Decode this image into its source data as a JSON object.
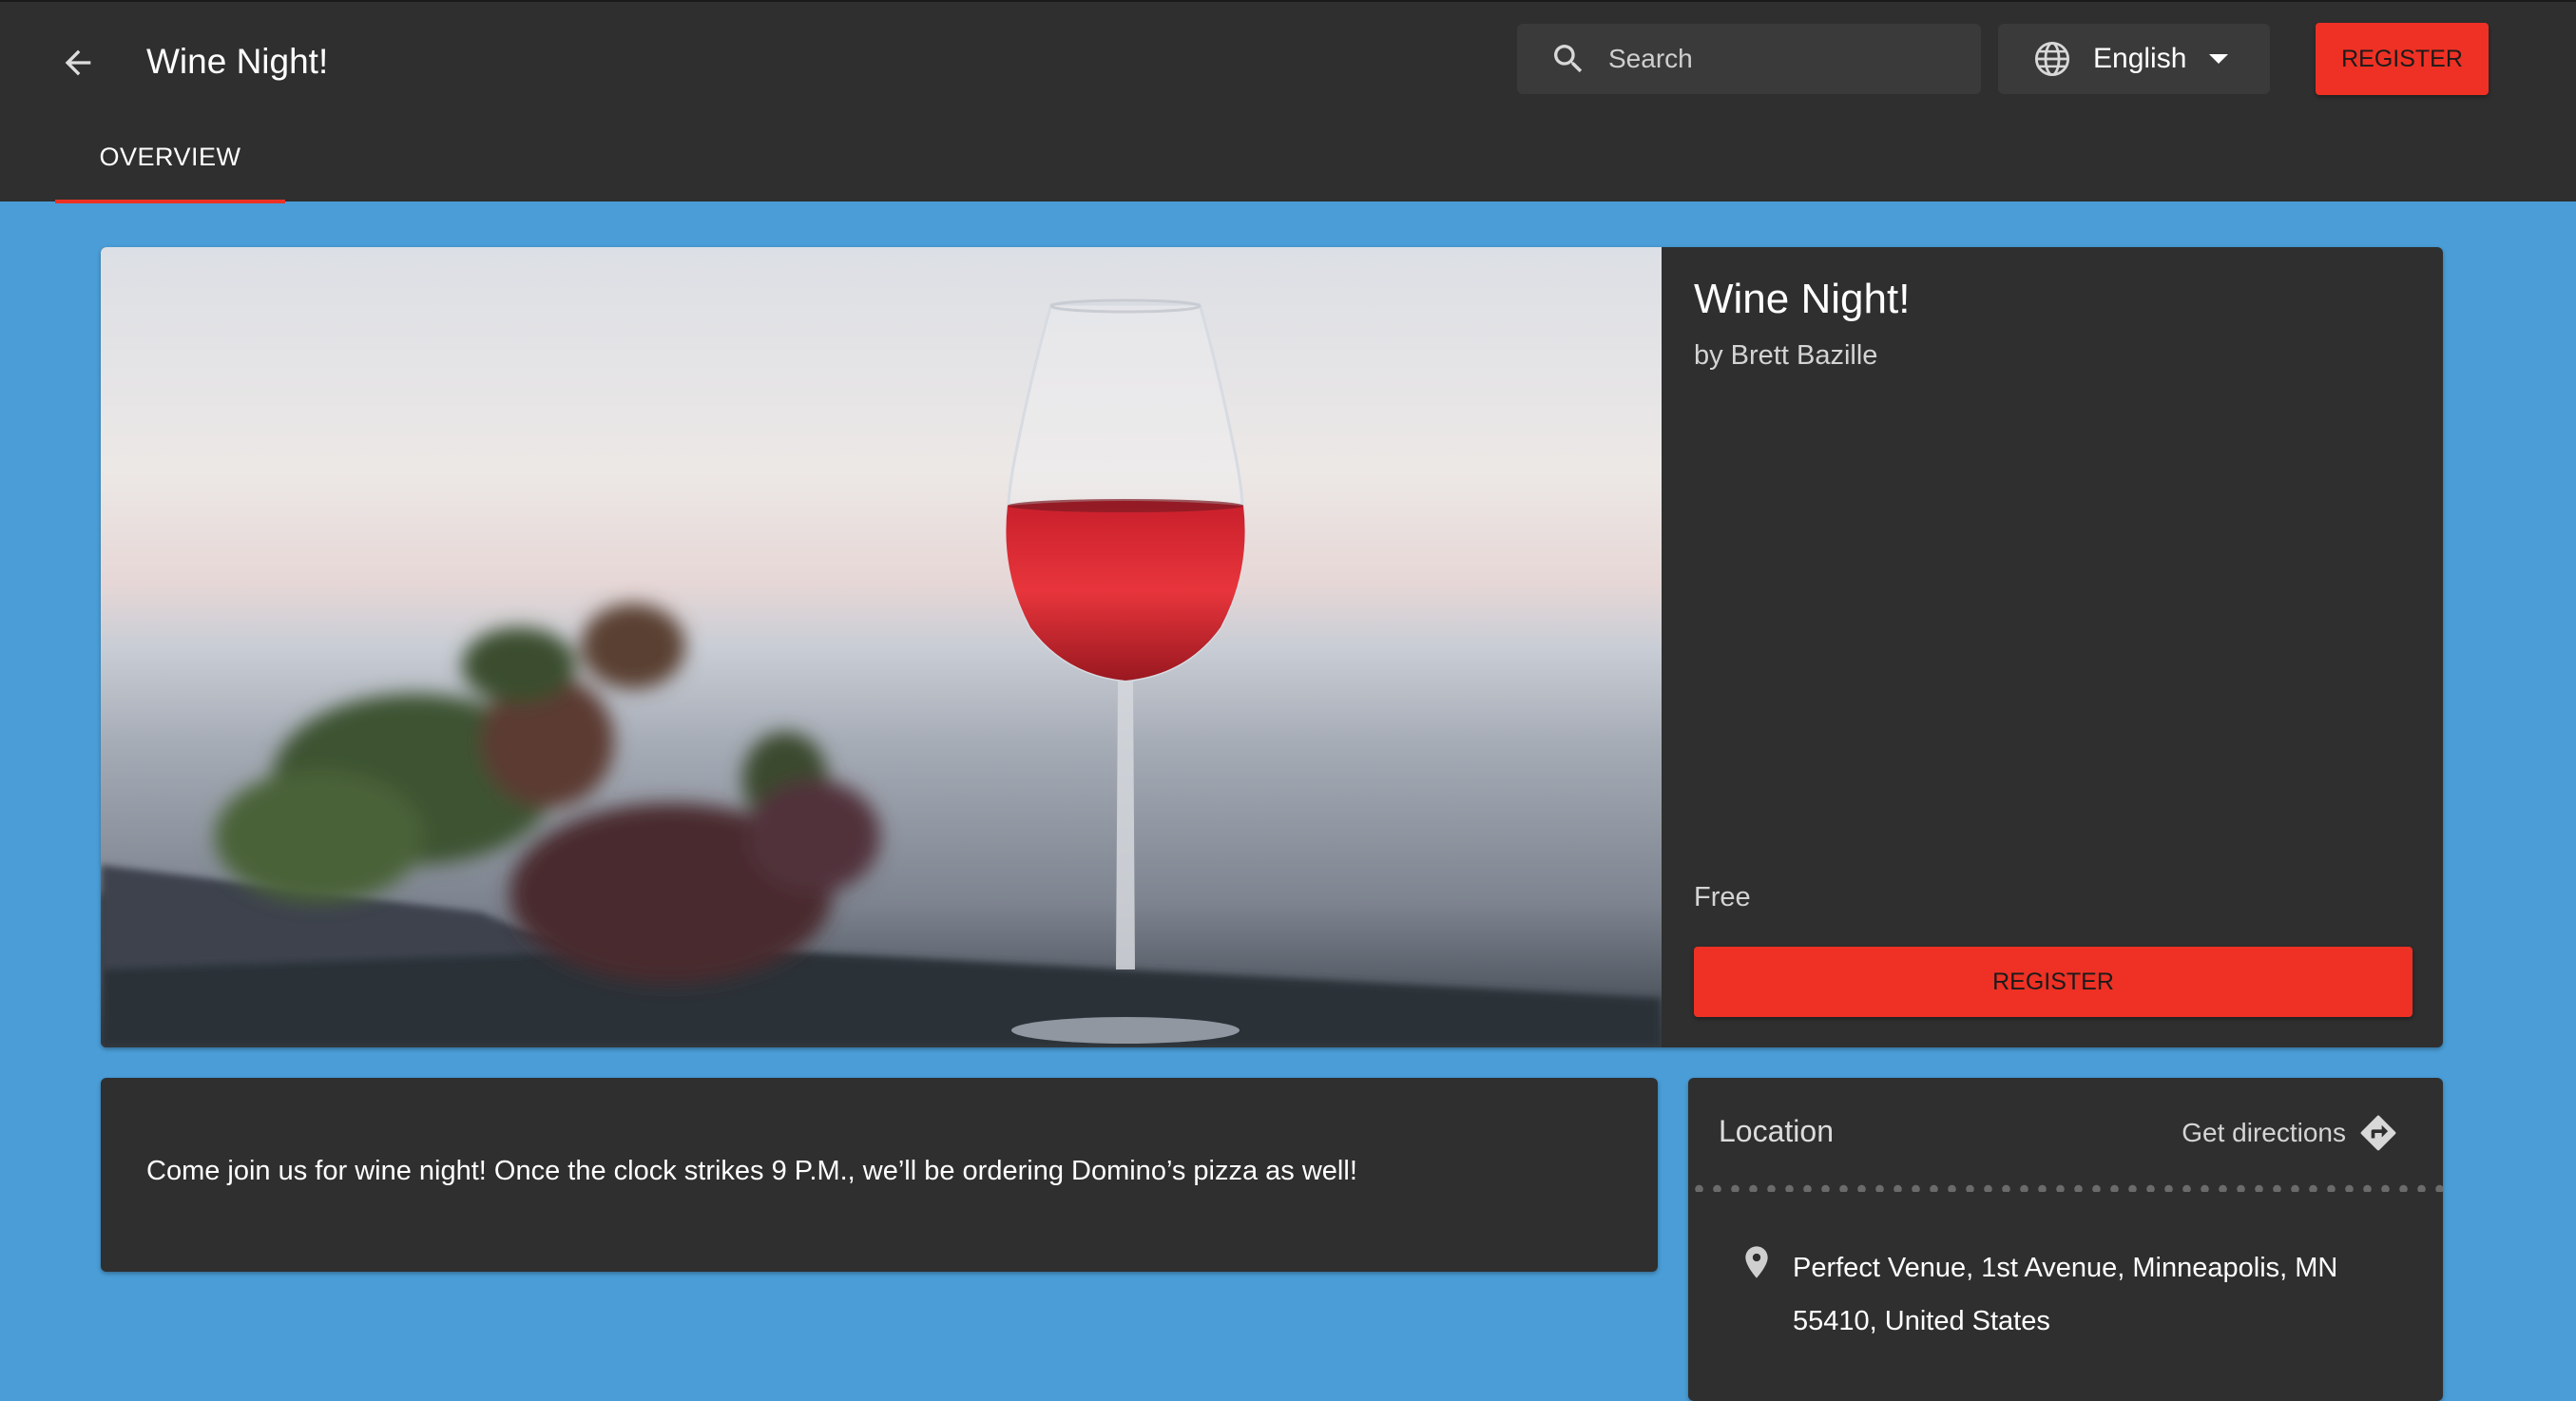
{
  "header": {
    "title": "Wine Night!",
    "back_icon": "arrow-left-icon",
    "search": {
      "placeholder": "Search",
      "value": ""
    },
    "language": {
      "selected": "English"
    },
    "register_label": "REGISTER"
  },
  "tabs": [
    {
      "label": "OVERVIEW",
      "active": true
    }
  ],
  "event": {
    "title": "Wine Night!",
    "organizer": "by Brett Bazille",
    "price": "Free",
    "register_label": "REGISTER",
    "description": "Come join us for wine night! Once the clock strikes 9 P.M., we’ll be ordering Domino’s pizza as well!"
  },
  "location": {
    "title": "Location",
    "directions_label": "Get directions",
    "address_line1": "Perfect Venue, 1st Avenue, Minneapolis, MN",
    "address_line2": "55410, United States"
  },
  "colors": {
    "page_background": "#4a9dd6",
    "bar_background": "#2f2f2f",
    "accent_red": "#ee3124"
  }
}
